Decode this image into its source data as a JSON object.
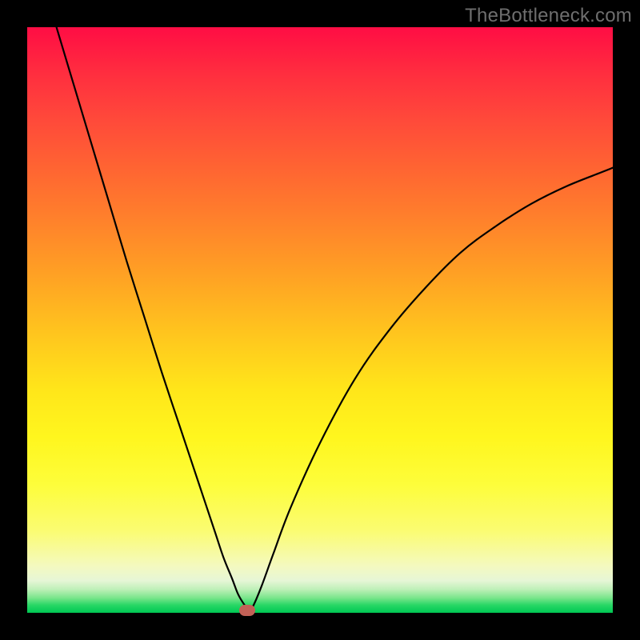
{
  "watermark": "TheBottleneck.com",
  "chart_data": {
    "type": "line",
    "title": "",
    "xlabel": "",
    "ylabel": "",
    "xlim": [
      0,
      100
    ],
    "ylim": [
      0,
      100
    ],
    "x": [
      5,
      8,
      11,
      14,
      17,
      20,
      23,
      26,
      29,
      32,
      33.5,
      35,
      36,
      37,
      37.8,
      38.5,
      40,
      42,
      45,
      50,
      56,
      62,
      68,
      74,
      80,
      86,
      92,
      98,
      100
    ],
    "values": [
      100,
      90,
      80,
      70,
      60,
      50.5,
      41,
      32,
      23,
      14,
      9.5,
      5.8,
      3.2,
      1.5,
      0.5,
      1.0,
      4.5,
      10,
      18,
      29,
      40,
      48.5,
      55.5,
      61.5,
      66,
      69.8,
      72.8,
      75.2,
      76
    ],
    "background_gradient": {
      "type": "vertical",
      "stops": [
        {
          "pos": 0.0,
          "color": "#ff0d44"
        },
        {
          "pos": 0.5,
          "color": "#ffc41e"
        },
        {
          "pos": 0.8,
          "color": "#fdfd3a"
        },
        {
          "pos": 0.95,
          "color": "#bef0b8"
        },
        {
          "pos": 1.0,
          "color": "#00c853"
        }
      ]
    },
    "marker": {
      "x": 37.5,
      "y": 0.4,
      "color": "#c26157"
    },
    "frame_color": "#000000"
  }
}
